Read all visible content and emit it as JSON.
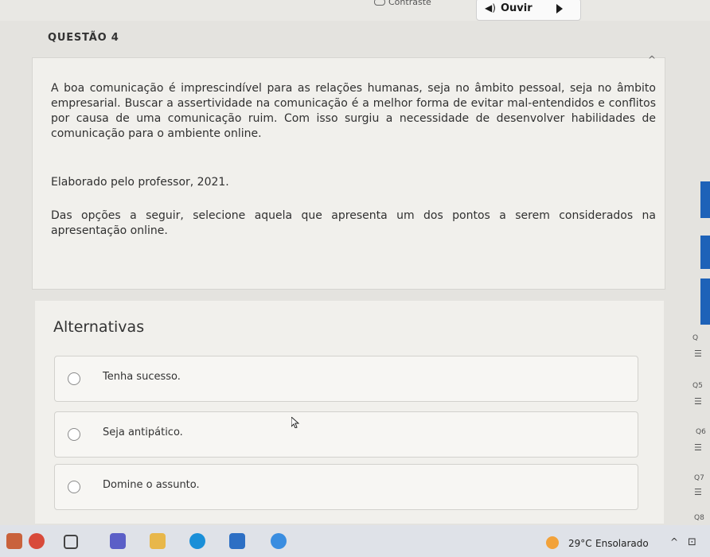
{
  "toolbar": {
    "contrast_label": "Contraste",
    "listen_label": "Ouvir"
  },
  "question": {
    "title": "QUESTÃO 4",
    "paragraph1": "A boa comunicação é imprescindível para as relações humanas, seja no âmbito pessoal, seja no âmbito empresarial. Buscar a assertividade na comunicação é a melhor forma de evitar mal-entendidos e conflitos por causa de uma comunicação ruim. Com isso surgiu a necessidade de desenvolver habilidades de comunicação para o ambiente online.",
    "source": "Elaborado pelo professor, 2021.",
    "prompt": "Das opções a seguir, selecione aquela que apresenta um dos pontos a serem considerados na apresentação online."
  },
  "alternatives": {
    "title": "Alternativas",
    "options": [
      {
        "label": "Tenha sucesso."
      },
      {
        "label": "Seja antipático."
      },
      {
        "label": "Domine o assunto."
      }
    ]
  },
  "side_nav": {
    "labels": [
      "Q",
      "Q5",
      "Q6",
      "Q7",
      "Q8"
    ]
  },
  "taskbar": {
    "temperature": "29°C",
    "weather": "Ensolarado",
    "icons": [
      "store-icon",
      "widgets-icon",
      "teams-icon",
      "files-icon",
      "edge-icon",
      "mail-icon",
      "chrome-icon"
    ]
  },
  "colors": {
    "page_bg": "#e4e3df",
    "card_bg": "#f1f0ec",
    "accent_blue": "#1e62b8",
    "weather_sun": "#f2a23a"
  }
}
